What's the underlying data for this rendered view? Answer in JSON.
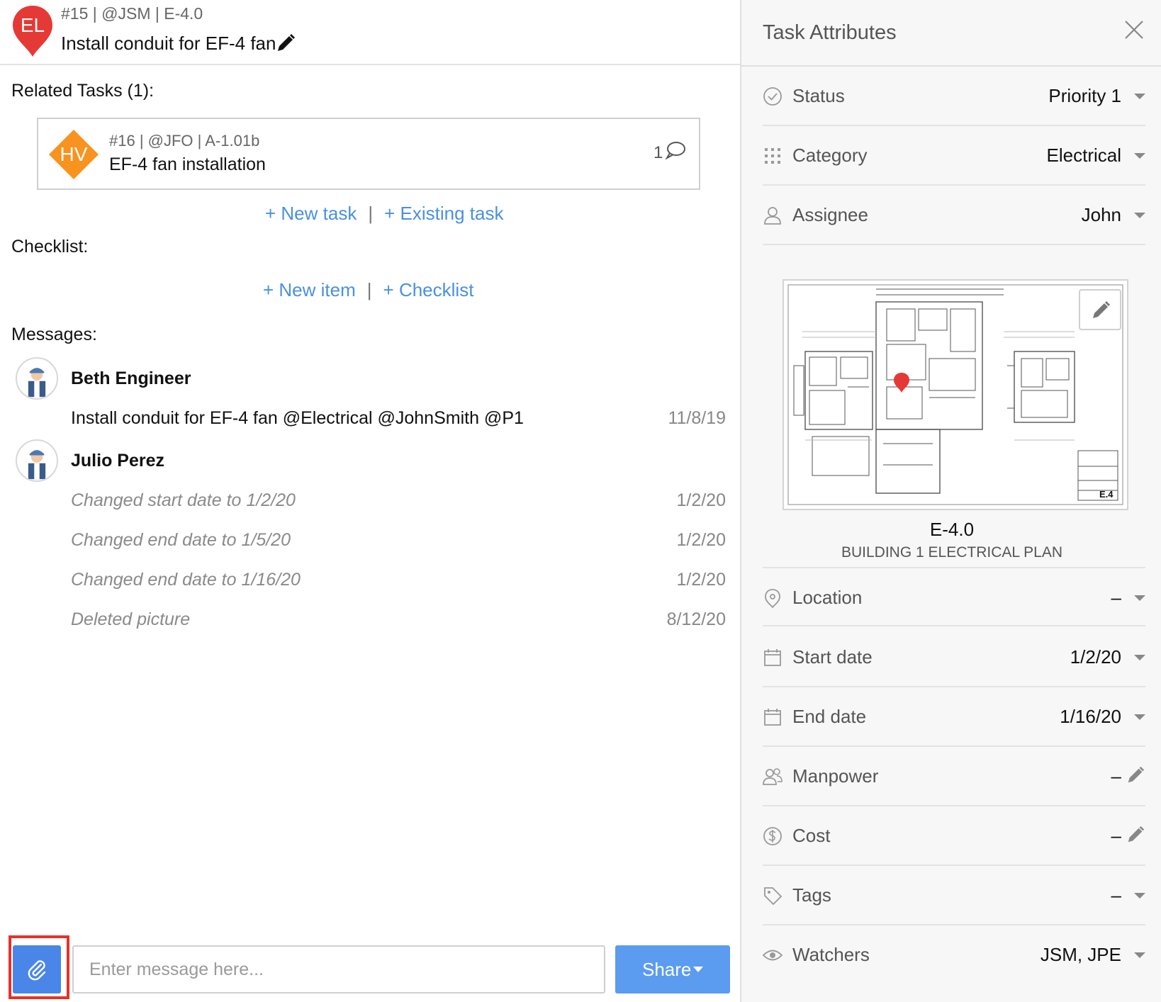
{
  "header": {
    "badge": "EL",
    "meta": "#15 | @JSM | E-4.0",
    "title": "Install conduit for EF-4 fan",
    "pin_color": "#e53935"
  },
  "related": {
    "label": "Related Tasks (1):",
    "items": [
      {
        "badge": "HV",
        "badge_color": "#f7931e",
        "meta": "#16 | @JFO | A-1.01b",
        "title": "EF-4 fan installation",
        "comment_count": "1"
      }
    ],
    "new_task": "+ New task",
    "existing_task": "+ Existing task",
    "separator": "|"
  },
  "checklist": {
    "label": "Checklist:",
    "new_item": "+ New item",
    "checklist_link": "+ Checklist",
    "separator": "|"
  },
  "messages": {
    "label": "Messages:",
    "threads": [
      {
        "author": "Beth Engineer",
        "entries": [
          {
            "text": "Install conduit for EF-4 fan @Electrical @JohnSmith  @P1",
            "date": "11/8/19"
          }
        ]
      },
      {
        "author": "Julio Perez",
        "entries": [
          {
            "text": "Changed start date to 1/2/20",
            "date": "1/2/20"
          },
          {
            "text": "Changed end date to 1/5/20",
            "date": "1/2/20"
          },
          {
            "text": "Changed end date to 1/16/20",
            "date": "1/2/20"
          },
          {
            "text": "Deleted picture",
            "date": "8/12/20"
          }
        ]
      }
    ]
  },
  "composer": {
    "placeholder": "Enter message here...",
    "share_label": "Share"
  },
  "panel": {
    "title": "Task Attributes",
    "attributes_top": [
      {
        "label": "Status",
        "value": "Priority 1",
        "icon": "check-circle-icon"
      },
      {
        "label": "Category",
        "value": "Electrical",
        "icon": "grid-dots-icon"
      },
      {
        "label": "Assignee",
        "value": "John",
        "icon": "person-icon"
      }
    ],
    "plan": {
      "sheet": "E-4.0",
      "name": "BUILDING 1 ELECTRICAL PLAN",
      "stamp": "E.4"
    },
    "attributes_bottom": [
      {
        "label": "Location",
        "value": "–",
        "icon": "location-pin-icon",
        "control": "dropdown"
      },
      {
        "label": "Start date",
        "value": "1/2/20",
        "icon": "calendar-icon",
        "control": "dropdown"
      },
      {
        "label": "End date",
        "value": "1/16/20",
        "icon": "calendar-icon",
        "control": "dropdown"
      },
      {
        "label": "Manpower",
        "value": "–",
        "icon": "people-icon",
        "control": "edit"
      },
      {
        "label": "Cost",
        "value": "–",
        "icon": "dollar-circle-icon",
        "control": "edit"
      },
      {
        "label": "Tags",
        "value": "–",
        "icon": "tag-icon",
        "control": "dropdown"
      },
      {
        "label": "Watchers",
        "value": "JSM, JPE",
        "icon": "eye-icon",
        "control": "dropdown"
      }
    ]
  },
  "colors": {
    "link": "#4a90e2",
    "primary_button": "#5b9bf0",
    "attach_button": "#4a86e8",
    "highlight": "#e8302a"
  }
}
